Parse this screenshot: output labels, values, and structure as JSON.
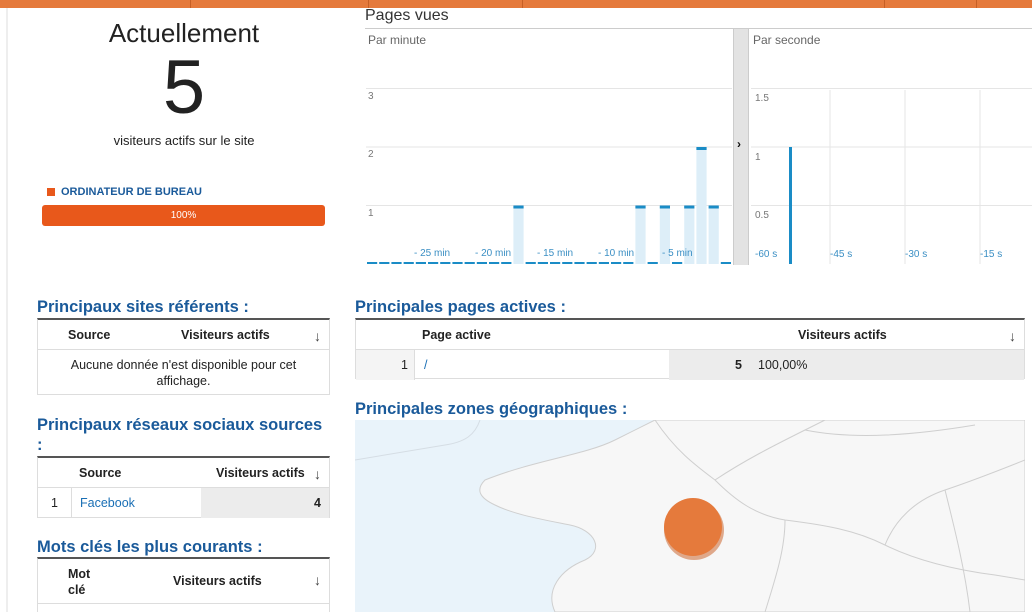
{
  "current": {
    "title": "Actuellement",
    "count": "5",
    "subtitle": "visiteurs actifs sur le site",
    "device_label": "ORDINATEUR DE BUREAU",
    "device_percent_text": "100%",
    "device_fraction": 1.0,
    "device_color": "#e8581b"
  },
  "pageviews": {
    "title": "Pages vues",
    "per_minute": {
      "label": "Par minute",
      "y_ticks": [
        "3",
        "2",
        "1"
      ],
      "x_ticks": [
        "- 25 min",
        "- 20 min",
        "- 15 min",
        "- 10 min",
        "- 5 min"
      ],
      "values": [
        0,
        0,
        0,
        0,
        0,
        0,
        0,
        0,
        0,
        0,
        0,
        0,
        1,
        0,
        0,
        0,
        0,
        0,
        0,
        0,
        0,
        0,
        1,
        0,
        1,
        0,
        1,
        2,
        1,
        0
      ]
    },
    "per_second": {
      "label": "Par seconde",
      "y_ticks": [
        "1.5",
        "1",
        "0.5"
      ],
      "x_ticks": [
        "-60 s",
        "-45 s",
        "-30 s",
        "-15 s"
      ],
      "spike_value": 1
    },
    "expand_icon": "chevron-right-icon"
  },
  "referrers": {
    "title": "Principaux sites référents :",
    "col_source": "Source",
    "col_visitors": "Visiteurs actifs",
    "empty_text": "Aucune donnée n'est disponible pour cet affichage."
  },
  "social": {
    "title": "Principaux réseaux sociaux sources :",
    "col_source": "Source",
    "col_visitors": "Visiteurs actifs",
    "rows": [
      {
        "index": "1",
        "source": "Facebook",
        "visitors": "4"
      }
    ]
  },
  "keywords": {
    "title": "Mots clés les plus courants :",
    "col_keyword": "Mot clé",
    "col_visitors": "Visiteurs actifs"
  },
  "pages": {
    "title": "Principales pages actives :",
    "col_page": "Page active",
    "col_visitors": "Visiteurs actifs",
    "rows": [
      {
        "index": "1",
        "page": "/",
        "visitors": "5",
        "percent": "100,00%"
      }
    ]
  },
  "geo": {
    "title": "Principales zones géographiques :",
    "bubble_color": "#e57a3c"
  },
  "colors": {
    "accent_orange": "#e57a3c",
    "link_blue": "#1a5a9a",
    "bar_blue": "#1a8cc6",
    "bar_fill": "#ddeef8"
  }
}
